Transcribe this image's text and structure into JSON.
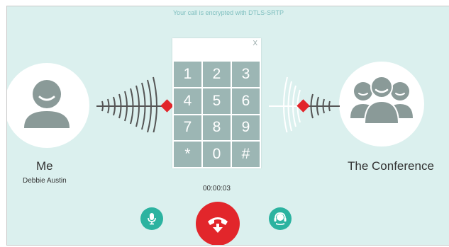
{
  "header": {
    "encryption_notice": "Your call is encrypted with DTLS-SRTP"
  },
  "local": {
    "label": "Me",
    "name": "Debbie Austin",
    "icon": "user-icon"
  },
  "remote": {
    "label": "The Conference",
    "icon": "group-icon"
  },
  "dialpad": {
    "close_label": "X",
    "keys": [
      "1",
      "2",
      "3",
      "4",
      "5",
      "6",
      "7",
      "8",
      "9",
      "*",
      "0",
      "#"
    ]
  },
  "call": {
    "timer": "00:00:03"
  },
  "controls": {
    "mic_icon": "microphone-icon",
    "hangup_icon": "hang-up-icon",
    "headset_icon": "headset-icon"
  },
  "colors": {
    "background": "#dbf0ee",
    "accent": "#2cb3a0",
    "hangup": "#e2262b",
    "key": "#9cb6b4",
    "signal": "#e2262b"
  }
}
